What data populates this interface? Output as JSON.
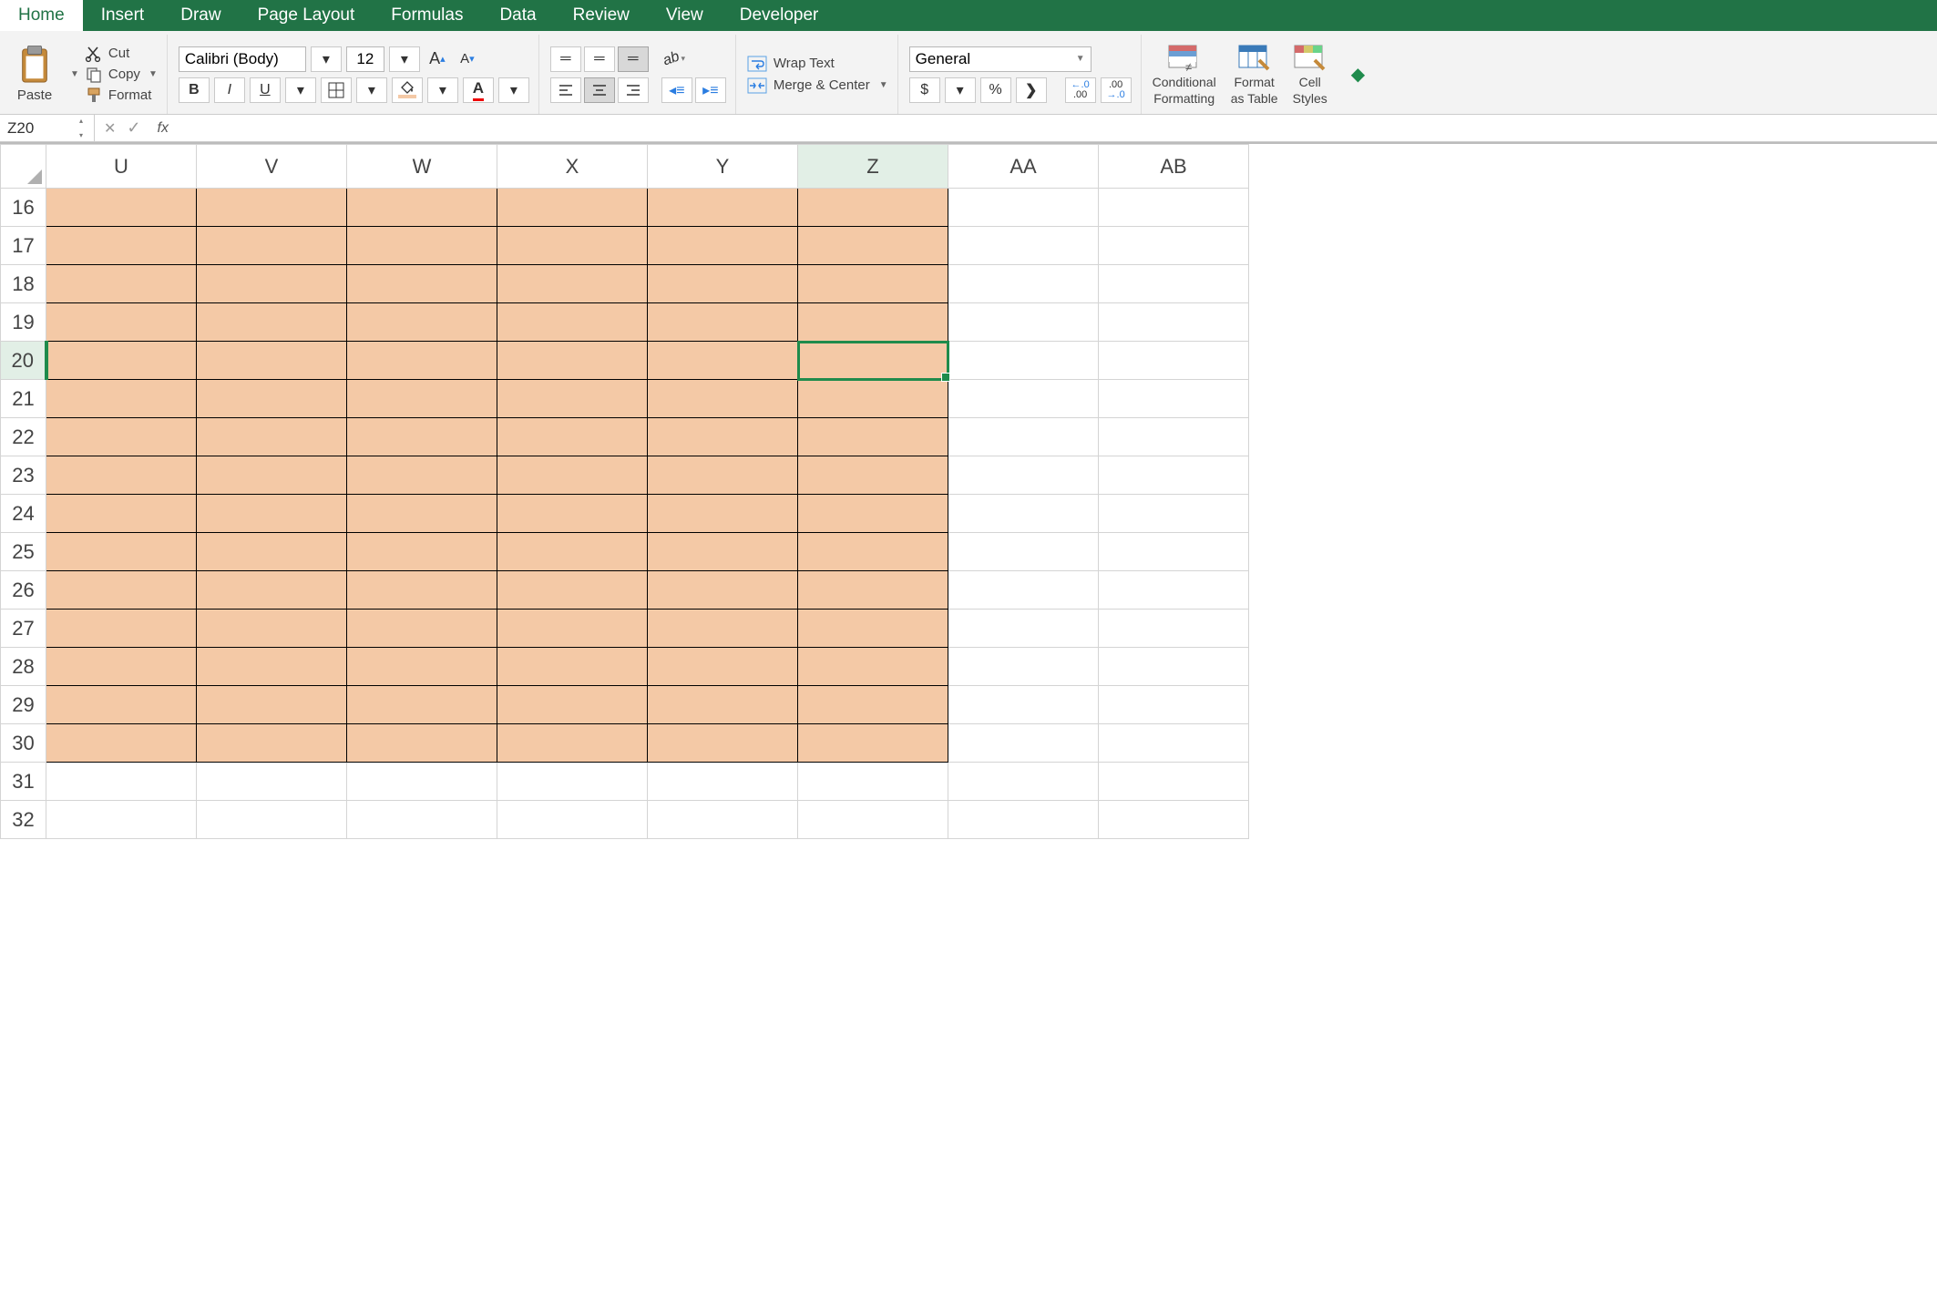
{
  "ribbon": {
    "tabs": [
      "Home",
      "Insert",
      "Draw",
      "Page Layout",
      "Formulas",
      "Data",
      "Review",
      "View",
      "Developer"
    ],
    "active_index": 0
  },
  "clipboard": {
    "paste_label": "Paste",
    "cut_label": "Cut",
    "copy_label": "Copy",
    "format_label": "Format"
  },
  "font": {
    "name": "Calibri (Body)",
    "size": "12",
    "inc_label": "A",
    "dec_label": "A",
    "bold": "B",
    "italic": "I",
    "underline": "U",
    "font_color_letter": "A"
  },
  "alignment": {
    "wrap_text": "Wrap Text",
    "merge_center": "Merge & Center"
  },
  "number": {
    "format": "General",
    "currency": "$",
    "percent": "%",
    "comma": "❯",
    "inc_dec": ".0",
    "inc_dec2": ".00",
    "dec_inc": ".00",
    "dec_inc2": ".0"
  },
  "styles": {
    "conditional": "Conditional",
    "formatting": "Formatting",
    "format_as": "Format",
    "as_table": "as Table",
    "cell": "Cell",
    "cell_styles": "Styles"
  },
  "namebox": "Z20",
  "fx_value": "",
  "grid": {
    "columns": [
      "U",
      "V",
      "W",
      "X",
      "Y",
      "Z",
      "AA",
      "AB"
    ],
    "rows": [
      16,
      17,
      18,
      19,
      20,
      21,
      22,
      23,
      24,
      25,
      26,
      27,
      28,
      29,
      30,
      31,
      32
    ],
    "fill_cols": [
      "U",
      "V",
      "W",
      "X",
      "Y",
      "Z"
    ],
    "fill_rows_through": 30,
    "selected": {
      "col": "Z",
      "row": 20
    }
  }
}
